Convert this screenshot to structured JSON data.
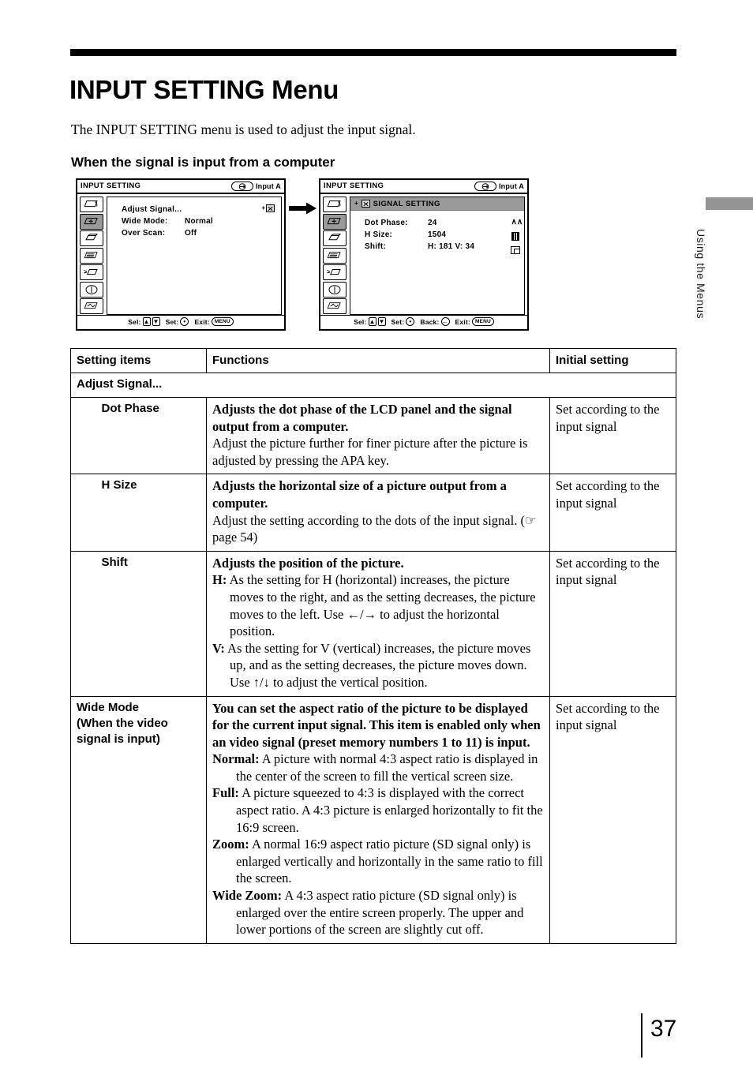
{
  "document": {
    "title": "INPUT SETTING Menu",
    "intro": "The INPUT SETTING menu is used to adjust the input signal.",
    "subheading": "When the signal is input from a computer",
    "page_number": "37",
    "margin_tab": "Using the Menus",
    "tab_color": "#949494"
  },
  "osd_left": {
    "title": "INPUT SETTING",
    "input_label": "Input A",
    "rows": [
      {
        "key": "Adjust Signal...",
        "value": ""
      },
      {
        "key": "Wide Mode:",
        "value": "Normal"
      },
      {
        "key": "Over Scan:",
        "value": "Off"
      }
    ],
    "footer": [
      {
        "label": "Sel:",
        "keys": [
          "up-arrow-key",
          "down-arrow-key"
        ]
      },
      {
        "label": "Set:",
        "keys": [
          "enter-key"
        ]
      },
      {
        "label": "Exit:",
        "keys": [
          "MENU"
        ]
      }
    ],
    "selected_sidebar_index": 1,
    "sidebar_icon_count": 7
  },
  "osd_right": {
    "title": "INPUT SETTING",
    "input_label": "Input A",
    "panel_header": "SIGNAL SETTING",
    "rows": [
      {
        "key": "Dot Phase:",
        "value": "24"
      },
      {
        "key": "H Size:",
        "value": "1504"
      },
      {
        "key": "Shift:",
        "value": "H: 181  V: 34"
      }
    ],
    "side_marks": [
      "dot-phase-icon",
      "h-size-icon",
      "shift-icon"
    ],
    "footer": [
      {
        "label": "Sel:",
        "keys": [
          "up-arrow-key",
          "down-arrow-key"
        ]
      },
      {
        "label": "Set:",
        "keys": [
          "enter-key"
        ]
      },
      {
        "label": "Back:",
        "keys": [
          "back-key"
        ]
      },
      {
        "label": "Exit:",
        "keys": [
          "MENU"
        ]
      }
    ],
    "selected_sidebar_index": 1,
    "sidebar_icon_count": 7
  },
  "table": {
    "headers": {
      "setting_items": "Setting items",
      "functions": "Functions",
      "initial_setting": "Initial setting"
    },
    "group_label": "Adjust Signal...",
    "rows": [
      {
        "name": "Dot Phase",
        "bold_text": "Adjusts the dot phase of the LCD panel and the signal output from a computer.",
        "body_text": "Adjust the picture further for finer picture after the picture is adjusted by pressing the APA key.",
        "initial": "Set according to the input signal"
      },
      {
        "name": "H Size",
        "bold_text": "Adjusts the horizontal size of a picture output from a computer.",
        "body_text": "Adjust the setting according to the dots of the input signal.  (☞ page 54)",
        "initial": "Set according to the input signal"
      },
      {
        "name": "Shift",
        "bold_text": "Adjusts the position of the picture.",
        "defs": [
          {
            "term": "H:",
            "text": "As the setting for H (horizontal) increases, the picture moves to the right, and as the setting decreases, the picture moves to the left. Use ←/→ to adjust the horizontal position."
          },
          {
            "term": "V:",
            "text": "As the setting for V (vertical) increases, the picture moves up, and as the setting decreases, the picture moves down. Use ↑/↓ to adjust the vertical position."
          }
        ],
        "initial": "Set according to the input signal"
      }
    ],
    "wide_mode": {
      "name_line1": "Wide Mode",
      "name_line2": "(When the video",
      "name_line3": "signal is input)",
      "bold_text": "You can set the aspect ratio of the picture to be displayed for the current input signal. This item is enabled only when an video signal (preset memory numbers 1 to 11) is input.",
      "defs": [
        {
          "term": "Normal:",
          "text": "A picture with normal 4:3 aspect ratio is displayed in the center of the screen to fill the vertical screen size."
        },
        {
          "term": "Full:",
          "text": "A picture squeezed to 4:3 is displayed with the correct aspect ratio. A 4:3 picture is enlarged horizontally to fit the 16:9 screen."
        },
        {
          "term": "Zoom:",
          "text": "A normal 16:9 aspect ratio picture (SD signal only) is enlarged vertically and horizontally in the same ratio to fill the screen."
        },
        {
          "term": "Wide Zoom:",
          "text": "A 4:3 aspect ratio picture (SD signal only) is enlarged over the entire screen properly. The upper and lower portions of the screen are slightly cut off."
        }
      ],
      "initial": "Set according to the input signal"
    }
  }
}
